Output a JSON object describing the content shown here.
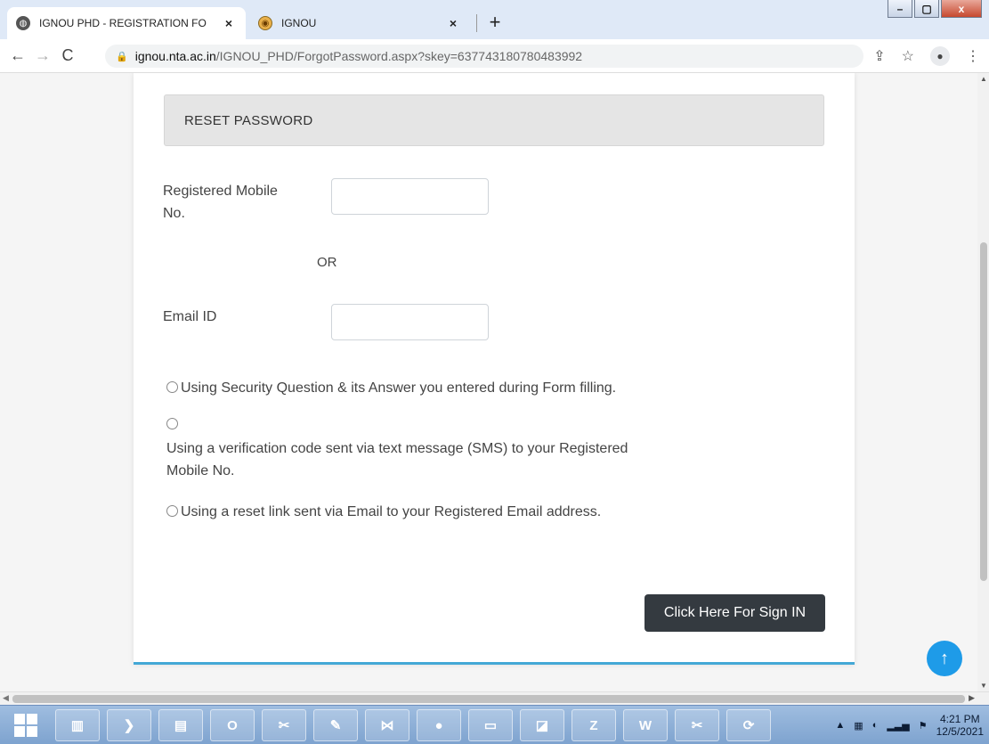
{
  "browser": {
    "tabs": [
      {
        "label": "IGNOU PHD - REGISTRATION FO",
        "close": "×",
        "active": true
      },
      {
        "label": "IGNOU",
        "close": "×",
        "active": false
      }
    ],
    "new_tab": "+",
    "window_buttons": {
      "minimize": "–",
      "maximize": "▢",
      "close": "x"
    },
    "url_host": "ignou.nta.ac.in",
    "url_path": "/IGNOU_PHD/ForgotPassword.aspx?skey=637743180780483992"
  },
  "form": {
    "header": "RESET PASSWORD",
    "mobile_label_line1": "Registered Mobile",
    "mobile_label_line2": "No.",
    "mobile_value": "",
    "or_text": "OR",
    "email_label": "Email ID",
    "email_value": "",
    "options": [
      "Using Security Question & its Answer you entered during Form filling.",
      "Using a verification code sent via text message (SMS) to your Registered",
      "Mobile No.",
      "Using a reset link sent via Email to your Registered Email address."
    ],
    "signin_button": "Click Here For Sign IN"
  },
  "scroll_top_icon": "↑",
  "taskbar": {
    "apps": [
      "server-manager",
      "powershell",
      "control-panel",
      "outlook",
      "tools",
      "paint",
      "visual-studio",
      "chrome",
      "explorer",
      "notepad",
      "filezilla",
      "word",
      "tools-2",
      "network"
    ],
    "app_glyphs": [
      "▥",
      "❯",
      "▤",
      "O",
      "✂",
      "✎",
      "⋈",
      "●",
      "▭",
      "◪",
      "Z",
      "W",
      "✂",
      "⟳"
    ],
    "time": "4:21 PM",
    "date": "12/5/2021"
  },
  "colors": {
    "accent": "#44a8d6",
    "button": "#343a40",
    "scroll_top": "#1e9be8"
  }
}
